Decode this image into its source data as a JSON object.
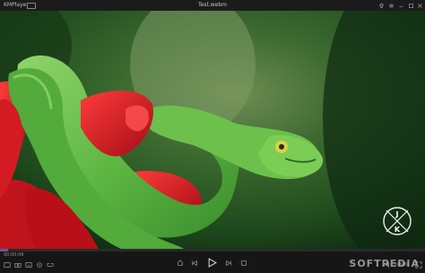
{
  "titlebar": {
    "app_name": "KMPlayer",
    "file_name": "Test.webm",
    "buttons": [
      "pin-icon",
      "menu-icon",
      "minimize-icon",
      "maximize-icon",
      "close-icon"
    ]
  },
  "player": {
    "time": "00:00:09",
    "progress_fraction": 0.02,
    "logo_letters": [
      "J",
      "K"
    ]
  },
  "colors": {
    "accent": "#5a5f9e",
    "titlebar_bg": "#1b1b1b",
    "controls_bg": "#161616"
  },
  "watermark": "SOFTPEDIA"
}
